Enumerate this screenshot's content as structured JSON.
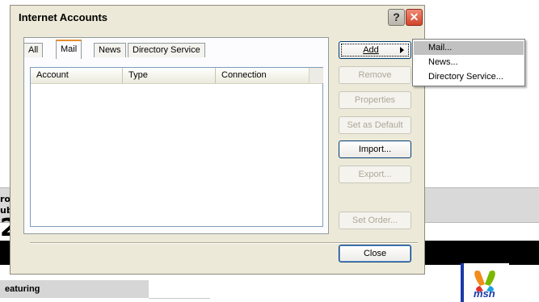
{
  "background": {
    "left_fragment_1": "ro",
    "left_fragment_2": "ub",
    "left_fragment_3": "2",
    "featuring": "eaturing",
    "msn_logo_text": "msn"
  },
  "dialog": {
    "title": "Internet Accounts",
    "help_symbol": "?",
    "close_symbol": "✕",
    "tabs": [
      {
        "label": "All"
      },
      {
        "label": "Mail"
      },
      {
        "label": "News"
      },
      {
        "label": "Directory Service"
      }
    ],
    "active_tab": "Mail",
    "list": {
      "columns": [
        "Account",
        "Type",
        "Connection"
      ],
      "rows": []
    },
    "buttons": {
      "add": "Add",
      "remove": "Remove",
      "properties": "Properties",
      "set_default": "Set as Default",
      "import": "Import...",
      "export": "Export...",
      "set_order": "Set Order...",
      "close": "Close"
    }
  },
  "add_menu": {
    "items": [
      "Mail...",
      "News...",
      "Directory Service..."
    ],
    "highlighted": "Mail..."
  },
  "colors": {
    "dialog_bg": "#ece9d8",
    "active_tab_accent": "#e68b2c",
    "close_button_red": "#d2442c",
    "menu_highlight": "#c1c1c1",
    "msn_blue": "#1a3aa8"
  }
}
